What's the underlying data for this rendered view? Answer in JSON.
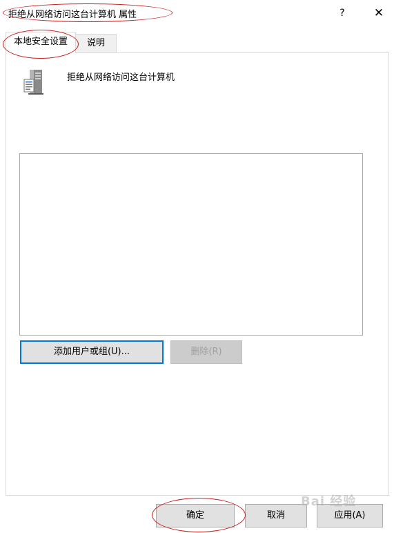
{
  "window": {
    "title": "拒绝从网络访问这台计算机 属性",
    "help_label": "?",
    "close_label": "✕"
  },
  "tabs": [
    {
      "label": "本地安全设置",
      "active": true
    },
    {
      "label": "说明",
      "active": false
    }
  ],
  "policy": {
    "name": "拒绝从网络访问这台计算机",
    "icon": "server-icon"
  },
  "accounts": [],
  "buttons": {
    "add_label": "添加用户或组(U)...",
    "remove_label": "删除(R)",
    "ok_label": "确定",
    "cancel_label": "取消",
    "apply_label": "应用(A)"
  },
  "annotations": {
    "color": "#cc1f1f"
  },
  "watermark": {
    "text": "Bai 经验"
  }
}
